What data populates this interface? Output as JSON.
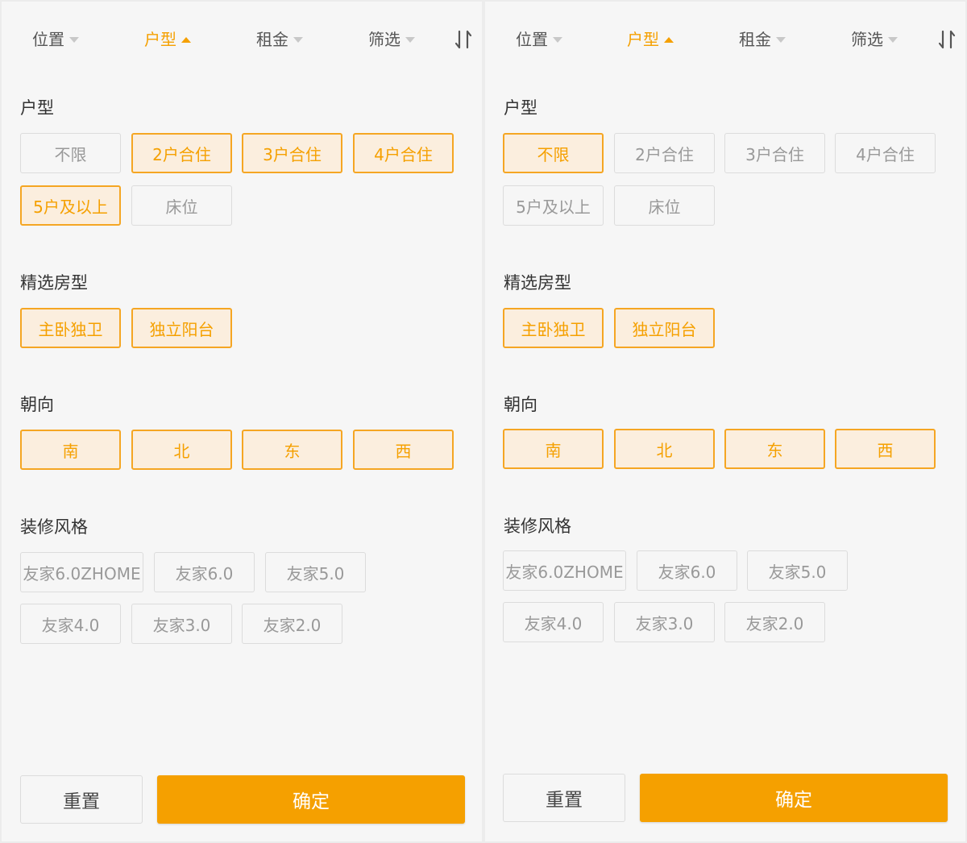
{
  "tabs": [
    {
      "label": "位置",
      "active": false
    },
    {
      "label": "户型",
      "active": true
    },
    {
      "label": "租金",
      "active": false
    },
    {
      "label": "筛选",
      "active": false
    }
  ],
  "sort_icon": "sort-icon",
  "accent_color": "#f5a000",
  "sections": {
    "layout": "户型",
    "featured": "精选房型",
    "orientation": "朝向",
    "style": "装修风格"
  },
  "panels": [
    {
      "layout_options": [
        {
          "label": "不限",
          "selected": false
        },
        {
          "label": "2户合住",
          "selected": true
        },
        {
          "label": "3户合住",
          "selected": true
        },
        {
          "label": "4户合住",
          "selected": true
        },
        {
          "label": "5户及以上",
          "selected": true
        },
        {
          "label": "床位",
          "selected": false
        }
      ],
      "featured_options": [
        {
          "label": "主卧独卫",
          "selected": true
        },
        {
          "label": "独立阳台",
          "selected": true
        }
      ],
      "orientation_options": [
        {
          "label": "南",
          "selected": true
        },
        {
          "label": "北",
          "selected": true
        },
        {
          "label": "东",
          "selected": true
        },
        {
          "label": "西",
          "selected": true
        }
      ],
      "style_options": [
        {
          "label": "友家6.0ZHOME",
          "selected": false
        },
        {
          "label": "友家6.0",
          "selected": false
        },
        {
          "label": "友家5.0",
          "selected": false
        },
        {
          "label": "友家4.0",
          "selected": false
        },
        {
          "label": "友家3.0",
          "selected": false
        },
        {
          "label": "友家2.0",
          "selected": false
        }
      ]
    },
    {
      "layout_options": [
        {
          "label": "不限",
          "selected": true
        },
        {
          "label": "2户合住",
          "selected": false
        },
        {
          "label": "3户合住",
          "selected": false
        },
        {
          "label": "4户合住",
          "selected": false
        },
        {
          "label": "5户及以上",
          "selected": false
        },
        {
          "label": "床位",
          "selected": false
        }
      ],
      "featured_options": [
        {
          "label": "主卧独卫",
          "selected": true
        },
        {
          "label": "独立阳台",
          "selected": true
        }
      ],
      "orientation_options": [
        {
          "label": "南",
          "selected": true
        },
        {
          "label": "北",
          "selected": true
        },
        {
          "label": "东",
          "selected": true
        },
        {
          "label": "西",
          "selected": true
        }
      ],
      "style_options": [
        {
          "label": "友家6.0ZHOME",
          "selected": false
        },
        {
          "label": "友家6.0",
          "selected": false
        },
        {
          "label": "友家5.0",
          "selected": false
        },
        {
          "label": "友家4.0",
          "selected": false
        },
        {
          "label": "友家3.0",
          "selected": false
        },
        {
          "label": "友家2.0",
          "selected": false
        }
      ]
    }
  ],
  "buttons": {
    "reset": "重置",
    "confirm": "确定"
  }
}
